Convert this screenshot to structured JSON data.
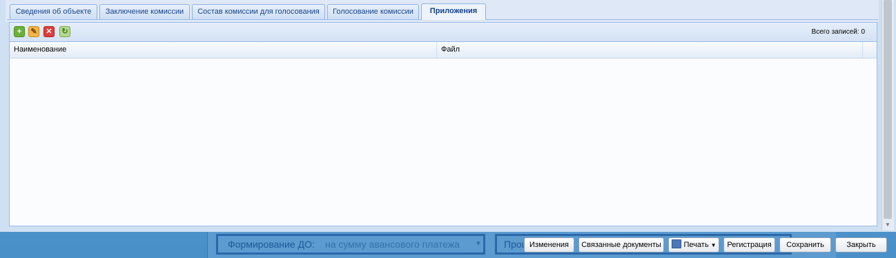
{
  "tabs": [
    "Сведения об объекте",
    "Заключение комиссии",
    "Состав комиссии для голосования",
    "Голосование комиссии",
    "Приложения"
  ],
  "active_tab_index": 4,
  "toolbar": {
    "add_icon": "add-icon",
    "edit_icon": "edit-icon",
    "delete_icon": "delete-icon",
    "refresh_icon": "refresh-icon",
    "total_label": "Всего записей:",
    "total_count": "0"
  },
  "grid": {
    "columns": [
      "Наименование",
      "Файл"
    ],
    "rows": []
  },
  "footer": {
    "changes": "Изменения",
    "related": "Связанные документы",
    "print": "Печать",
    "registration": "Регистрация",
    "save": "Сохранить",
    "close": "Закрыть"
  },
  "background": {
    "field_label": "Формирование ДО:",
    "field_value": "на сумму авансового платежа",
    "field2_label": "Проц"
  }
}
